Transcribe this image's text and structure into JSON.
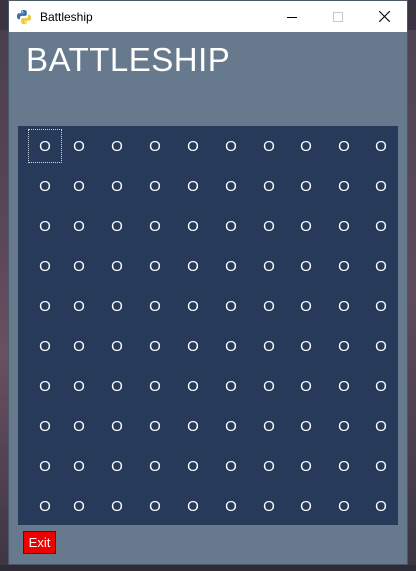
{
  "window": {
    "title": "Battleship",
    "icon": "python-icon",
    "controls": [
      "minimize-icon",
      "maximize-icon",
      "close-icon"
    ]
  },
  "app": {
    "heading": "BATTLESHIP",
    "exit_label": "Exit"
  },
  "board": {
    "rows": 10,
    "cols": 10,
    "focused_cell": [
      0,
      0
    ],
    "cells": [
      [
        "O",
        "O",
        "O",
        "O",
        "O",
        "O",
        "O",
        "O",
        "O",
        "O"
      ],
      [
        "O",
        "O",
        "O",
        "O",
        "O",
        "O",
        "O",
        "O",
        "O",
        "O"
      ],
      [
        "O",
        "O",
        "O",
        "O",
        "O",
        "O",
        "O",
        "O",
        "O",
        "O"
      ],
      [
        "O",
        "O",
        "O",
        "O",
        "O",
        "O",
        "O",
        "O",
        "O",
        "O"
      ],
      [
        "O",
        "O",
        "O",
        "O",
        "O",
        "O",
        "O",
        "O",
        "O",
        "O"
      ],
      [
        "O",
        "O",
        "O",
        "O",
        "O",
        "O",
        "O",
        "O",
        "O",
        "O"
      ],
      [
        "O",
        "O",
        "O",
        "O",
        "O",
        "O",
        "O",
        "O",
        "O",
        "O"
      ],
      [
        "O",
        "O",
        "O",
        "O",
        "O",
        "O",
        "O",
        "O",
        "O",
        "O"
      ],
      [
        "O",
        "O",
        "O",
        "O",
        "O",
        "O",
        "O",
        "O",
        "O",
        "O"
      ],
      [
        "O",
        "O",
        "O",
        "O",
        "O",
        "O",
        "O",
        "O",
        "O",
        "O"
      ]
    ]
  },
  "colors": {
    "window_bg": "#67798d",
    "board_bg": "#283a5a",
    "exit_bg": "#ee0000",
    "text": "#ffffff"
  }
}
